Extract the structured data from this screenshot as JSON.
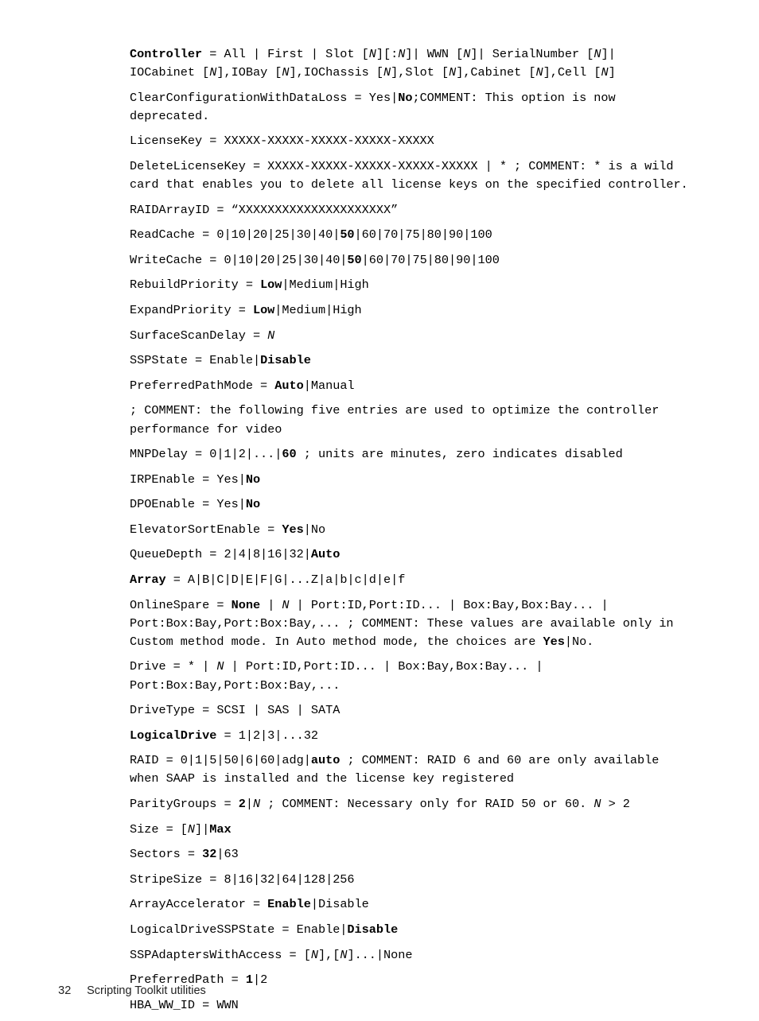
{
  "page": {
    "footer_page_number": "32",
    "footer_title": "Scripting Toolkit utilities",
    "background_color": "#ffffff",
    "text_color": "#000000"
  },
  "entries": [
    {
      "id": "controller",
      "key": "Controller",
      "key_bold": true,
      "text": "Controller = All | First | Slot [N][:N]| WWN [N]| SerialNumber [N]| IOCabinet [N],IOBay [N],IOChassis [N],Slot [N],Cabinet [N],Cell [N]",
      "html": "<b>Controller</b> = All | First | Slot [<i>N</i>][:<i>N</i>]| WWN [<i>N</i>]| SerialNumber [<i>N</i>]|\nIOCabinet [<i>N</i>],IOBay [<i>N</i>],IOChassis [<i>N</i>],Slot [<i>N</i>],Cabinet [<i>N</i>],Cell [<i>N</i>]"
    },
    {
      "id": "clear-configuration-with-data-loss",
      "key": "ClearConfigurationWithDataLoss",
      "key_bold": false,
      "text": "ClearConfigurationWithDataLoss = Yes|No;COMMENT: This option is now deprecated.",
      "html": "ClearConfigurationWithDataLoss = Yes|<b>No</b>;COMMENT: This option is now deprecated."
    },
    {
      "id": "license-key",
      "key": "LicenseKey",
      "key_bold": false,
      "text": "LicenseKey = XXXXX-XXXXX-XXXXX-XXXXX-XXXXX",
      "html": "LicenseKey = XXXXX-XXXXX-XXXXX-XXXXX-XXXXX"
    },
    {
      "id": "delete-license-key",
      "key": "DeleteLicenseKey",
      "key_bold": false,
      "text": "DeleteLicenseKey = XXXXX-XXXXX-XXXXX-XXXXX-XXXXX | * ; COMMENT: * is a wild card that enables you to delete all license keys on the specified controller.",
      "html": "DeleteLicenseKey = XXXXX-XXXXX-XXXXX-XXXXX-XXXXX | * ; COMMENT: * is a wild card that enables you to delete all license keys on the specified controller."
    },
    {
      "id": "raid-array-id",
      "key": "RAIDArrayID",
      "key_bold": false,
      "text": "RAIDArrayID = “XXXXXXXXXXXXXXXXXXXXX”",
      "html": "RAIDArrayID = “XXXXXXXXXXXXXXXXXXXXX”"
    },
    {
      "id": "read-cache",
      "key": "ReadCache",
      "key_bold": false,
      "text": "ReadCache = 0|10|20|25|30|40|50|60|70|75|80|90|100",
      "html": "ReadCache = 0|10|20|25|30|40|<b>50</b>|60|70|75|80|90|100"
    },
    {
      "id": "write-cache",
      "key": "WriteCache",
      "key_bold": false,
      "text": "WriteCache = 0|10|20|25|30|40|50|60|70|75|80|90|100",
      "html": "WriteCache = 0|10|20|25|30|40|<b>50</b>|60|70|75|80|90|100"
    },
    {
      "id": "rebuild-priority",
      "key": "RebuildPriority",
      "key_bold": false,
      "text": "RebuildPriority = Low|Medium|High",
      "html": "RebuildPriority = <b>Low</b>|Medium|High"
    },
    {
      "id": "expand-priority",
      "key": "ExpandPriority",
      "key_bold": false,
      "text": "ExpandPriority = Low|Medium|High",
      "html": "ExpandPriority = <b>Low</b>|Medium|High"
    },
    {
      "id": "surface-scan-delay",
      "key": "SurfaceScanDelay",
      "key_bold": false,
      "text": "SurfaceScanDelay = N",
      "html": "SurfaceScanDelay = <i>N</i>"
    },
    {
      "id": "ssp-state",
      "key": "SSPState",
      "key_bold": false,
      "text": "SSPState = Enable|Disable",
      "html": "SSPState = Enable|<b>Disable</b>"
    },
    {
      "id": "preferred-path-mode",
      "key": "PreferredPathMode",
      "key_bold": false,
      "text": "PreferredPathMode = Auto|Manual",
      "html": "PreferredPathMode = <b>Auto</b>|Manual"
    },
    {
      "id": "comment-video-optimize",
      "key": "",
      "key_bold": false,
      "text": "; COMMENT: the following five entries are used to optimize the controller performance for video",
      "html": "; COMMENT: the following five entries are used to optimize the controller performance for video"
    },
    {
      "id": "mnp-delay",
      "key": "MNPDelay",
      "key_bold": false,
      "text": "MNPDelay = 0|1|2|...|60 ; units are minutes, zero indicates disabled",
      "html": "MNPDelay = 0|1|2|...|<b>60</b> ; units are minutes, zero indicates disabled"
    },
    {
      "id": "irp-enable",
      "key": "IRPEnable",
      "key_bold": false,
      "text": "IRPEnable = Yes|No",
      "html": "IRPEnable = Yes|<b>No</b>"
    },
    {
      "id": "dpo-enable",
      "key": "DPOEnable",
      "key_bold": false,
      "text": "DPOEnable = Yes|No",
      "html": "DPOEnable = Yes|<b>No</b>"
    },
    {
      "id": "elevator-sort-enable",
      "key": "ElevatorSortEnable",
      "key_bold": false,
      "text": "ElevatorSortEnable = Yes|No",
      "html": "ElevatorSortEnable = <b>Yes</b>|No"
    },
    {
      "id": "queue-depth",
      "key": "QueueDepth",
      "key_bold": false,
      "text": "QueueDepth = 2|4|8|16|32|Auto",
      "html": "QueueDepth = 2|4|8|16|32|<b>Auto</b>"
    },
    {
      "id": "array",
      "key": "Array",
      "key_bold": true,
      "text": "Array = A|B|C|D|E|F|G|...Z|a|b|c|d|e|f",
      "html": "<b>Array</b> = A|B|C|D|E|F|G|...Z|a|b|c|d|e|f"
    },
    {
      "id": "online-spare",
      "key": "OnlineSpare",
      "key_bold": false,
      "text": "OnlineSpare = None | N | Port:ID,Port:ID... | Box:Bay,Box:Bay... | Port:Box:Bay,Port:Box:Bay,... ; COMMENT: These values are available only in Custom method mode. In Auto method mode, the choices are Yes|No.",
      "html": "OnlineSpare = <b>None</b> | <i>N</i> | Port:ID,Port:ID... | Box:Bay,Box:Bay... | Port:Box:Bay,Port:Box:Bay,... ; COMMENT: These values are available only in Custom method mode. In Auto method mode, the choices are <b>Yes</b>|No."
    },
    {
      "id": "drive",
      "key": "Drive",
      "key_bold": false,
      "text": "Drive = * | N | Port:ID,Port:ID... | Box:Bay,Box:Bay... | Port:Box:Bay,Port:Box:Bay,...",
      "html": "Drive = * | <i>N</i> | Port:ID,Port:ID... | Box:Bay,Box:Bay... |\nPort:Box:Bay,Port:Box:Bay,..."
    },
    {
      "id": "drive-type",
      "key": "DriveType",
      "key_bold": false,
      "text": "DriveType = SCSI | SAS | SATA",
      "html": "DriveType = SCSI | SAS | SATA"
    },
    {
      "id": "logical-drive",
      "key": "LogicalDrive",
      "key_bold": true,
      "text": "LogicalDrive = 1|2|3|...32",
      "html": "<b>LogicalDrive</b> = 1|2|3|...32"
    },
    {
      "id": "raid",
      "key": "RAID",
      "key_bold": false,
      "text": "RAID = 0|1|5|50|6|60|adg|auto ; COMMENT: RAID 6 and 60 are only available when SAAP is installed and the license key registered",
      "html": "RAID = 0|1|5|50|6|60|adg|<b>auto</b> ; COMMENT: RAID 6 and 60 are only available when SAAP is installed and the license key registered"
    },
    {
      "id": "parity-groups",
      "key": "ParityGroups",
      "key_bold": false,
      "text": "ParityGroups = 2|N ; COMMENT: Necessary only for RAID 50 or 60. N > 2",
      "html": "ParityGroups = <b>2</b>|<i>N</i> ; COMMENT: Necessary only for RAID 50 or 60. <i>N</i> > 2"
    },
    {
      "id": "size",
      "key": "Size",
      "key_bold": false,
      "text": "Size = [N]|Max",
      "html": "Size = [<i>N</i>]|<b>Max</b>"
    },
    {
      "id": "sectors",
      "key": "Sectors",
      "key_bold": false,
      "text": "Sectors = 32|63",
      "html": "Sectors = <b>32</b>|63"
    },
    {
      "id": "stripe-size",
      "key": "StripeSize",
      "key_bold": false,
      "text": "StripeSize = 8|16|32|64|128|256",
      "html": "StripeSize = 8|16|32|64|128|256"
    },
    {
      "id": "array-accelerator",
      "key": "ArrayAccelerator",
      "key_bold": false,
      "text": "ArrayAccelerator = Enable|Disable",
      "html": "ArrayAccelerator = <b>Enable</b>|Disable"
    },
    {
      "id": "logical-drive-ssp-state",
      "key": "LogicalDriveSSPState",
      "key_bold": false,
      "text": "LogicalDriveSSPState = Enable|Disable",
      "html": "LogicalDriveSSPState = Enable|<b>Disable</b>"
    },
    {
      "id": "ssp-adapters-with-access",
      "key": "SSPAdaptersWithAccess",
      "key_bold": false,
      "text": "SSPAdaptersWithAccess = [N],[N]...|None",
      "html": "SSPAdaptersWithAccess = [<i>N</i>],[<i>N</i>]...|None"
    },
    {
      "id": "preferred-path",
      "key": "PreferredPath",
      "key_bold": false,
      "text": "PreferredPath = 1|2",
      "html": "PreferredPath = <b>1</b>|2"
    },
    {
      "id": "hba-ww-id",
      "key": "HBA_WW_ID",
      "key_bold": false,
      "text": "HBA_WW_ID = WWN",
      "html": "HBA_WW_ID = WWN"
    }
  ]
}
